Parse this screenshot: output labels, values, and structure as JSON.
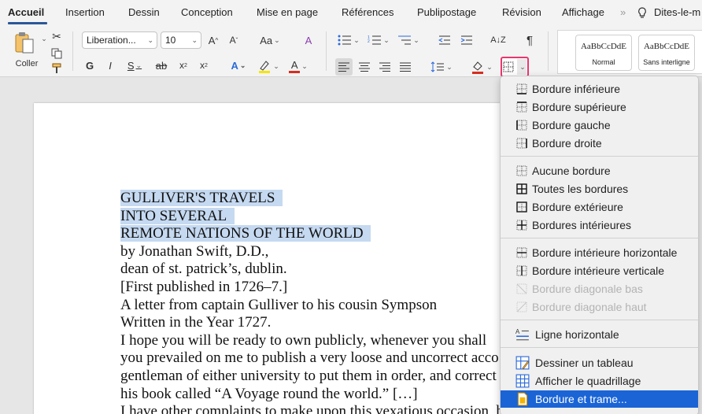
{
  "tabs": [
    {
      "label": "Accueil",
      "active": true
    },
    {
      "label": "Insertion"
    },
    {
      "label": "Dessin"
    },
    {
      "label": "Conception"
    },
    {
      "label": "Mise en page"
    },
    {
      "label": "Références"
    },
    {
      "label": "Publipostage"
    },
    {
      "label": "Révision"
    },
    {
      "label": "Affichage"
    }
  ],
  "tab_overflow": "»",
  "tell_me": "Dites-le-m",
  "ribbon": {
    "paste_label": "Coller",
    "font_name": "Liberation...",
    "font_size": "10",
    "styles": [
      {
        "sample": "AaBbCcDdE",
        "name": "Normal"
      },
      {
        "sample": "AaBbCcDdE",
        "name": "Sans interligne"
      }
    ]
  },
  "document": {
    "lines": [
      "GULLIVER'S TRAVELS",
      "INTO SEVERAL",
      "REMOTE NATIONS OF THE WORLD",
      "by Jonathan Swift, D.D.,",
      "dean of st. patrick’s, dublin.",
      "[First published in 1726–7.]",
      "A letter from captain Gulliver to his cousin Sympson",
      "Written in the Year 1727.",
      "I hope you will be ready to own publicly, whenever you shall",
      "you prevailed on me to publish a very loose and uncorrect acco",
      "gentleman of either university to put them in order, and correct",
      "his book called “A Voyage round the world.” […]",
      "I have other complaints to make upon this vexatious occasion, but I forbear troubling myself or"
    ]
  },
  "border_menu": {
    "items": [
      {
        "label": "Bordure inférieure",
        "icon": "border-bottom-icon"
      },
      {
        "label": "Bordure supérieure",
        "icon": "border-top-icon"
      },
      {
        "label": "Bordure gauche",
        "icon": "border-left-icon"
      },
      {
        "label": "Bordure droite",
        "icon": "border-right-icon"
      },
      {
        "label": "Aucune bordure",
        "icon": "no-border-icon"
      },
      {
        "label": "Toutes les bordures",
        "icon": "all-borders-icon"
      },
      {
        "label": "Bordure extérieure",
        "icon": "outside-borders-icon"
      },
      {
        "label": "Bordures intérieures",
        "icon": "inside-borders-icon"
      },
      {
        "label": "Bordure intérieure horizontale",
        "icon": "inside-horizontal-border-icon"
      },
      {
        "label": "Bordure intérieure verticale",
        "icon": "inside-vertical-border-icon"
      },
      {
        "label": "Bordure diagonale bas",
        "icon": "diagonal-down-border-icon",
        "disabled": true
      },
      {
        "label": "Bordure diagonale haut",
        "icon": "diagonal-up-border-icon",
        "disabled": true
      },
      {
        "label": "Ligne horizontale",
        "icon": "horizontal-line-icon"
      },
      {
        "label": "Dessiner un tableau",
        "icon": "draw-table-icon"
      },
      {
        "label": "Afficher le quadrillage",
        "icon": "view-gridlines-icon"
      },
      {
        "label": "Bordure et trame...",
        "icon": "borders-and-shading-icon",
        "selected": true
      }
    ]
  },
  "colors": {
    "accent": "#2b579a",
    "selection_highlight": "#c5d9f1",
    "menu_selected": "#1a64d6",
    "border_button_outline": "#e8366f",
    "font_color": "#d62d20",
    "highlight_color": "#f5e500"
  }
}
